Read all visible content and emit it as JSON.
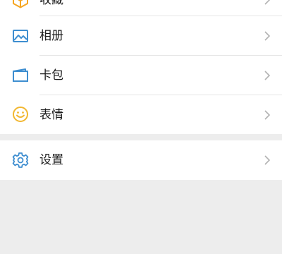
{
  "menu": {
    "items": [
      {
        "label": "收藏",
        "icon": "favorites-icon",
        "color": "#f5a623"
      },
      {
        "label": "相册",
        "icon": "album-icon",
        "color": "#3e8ed0"
      },
      {
        "label": "卡包",
        "icon": "card-wallet-icon",
        "color": "#3e8ed0"
      },
      {
        "label": "表情",
        "icon": "emoji-icon",
        "color": "#f2b730"
      }
    ],
    "settings": {
      "label": "设置",
      "icon": "gear-icon",
      "color": "#3e8ed0"
    }
  },
  "colors": {
    "background": "#ededed",
    "card": "#ffffff",
    "chevron": "#b2b2b2",
    "text": "#1a1a1a"
  }
}
